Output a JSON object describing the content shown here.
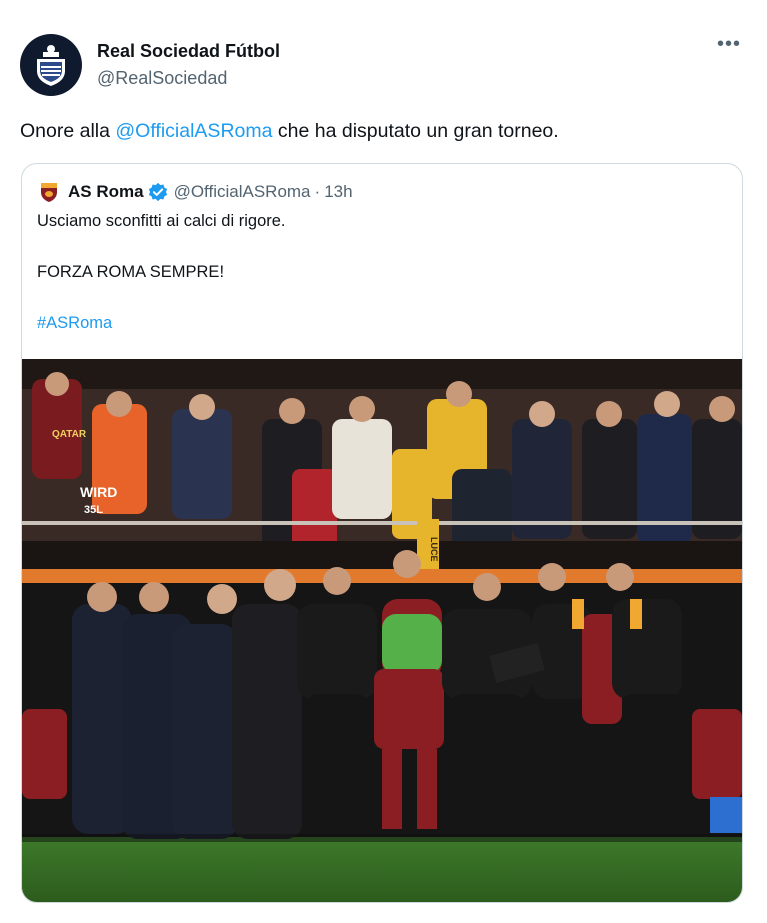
{
  "tweet": {
    "display_name": "Real Sociedad Fútbol",
    "handle": "@RealSociedad",
    "more_icon": "more-horizontal-icon",
    "text_prefix": "Onore alla ",
    "mention": "@OfficialASRoma",
    "text_suffix": " che ha disputato un gran torneo."
  },
  "quoted": {
    "display_name": "AS Roma",
    "verified_icon": "verified-badge-icon",
    "handle": "@OfficialASRoma",
    "separator": "·",
    "time": "13h",
    "lines": [
      "Usciamo sconfitti ai calci di rigore.",
      "FORZA ROMA SEMPRE!",
      "#ASRoma"
    ],
    "photo": {
      "vest_text": "WIRD",
      "vest_text2": "35L",
      "banner_text": "LUCE",
      "jersey_text": "QATAR"
    }
  },
  "colors": {
    "accent": "#1d9bf0",
    "secondary_text": "#536471",
    "border": "#cfd9de",
    "roma_red": "#8a1e22",
    "roma_gold": "#f0a830"
  }
}
